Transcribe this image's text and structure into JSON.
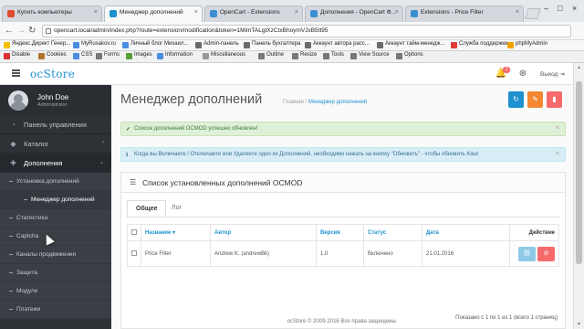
{
  "browser": {
    "tabs": [
      {
        "title": "Купить компьютеры",
        "active": false
      },
      {
        "title": "Менеджер дополнений",
        "active": true
      },
      {
        "title": "OpenCart - Extensions",
        "active": false
      },
      {
        "title": "Дополнения - OpenCart Ф...",
        "active": false
      },
      {
        "title": "Extensions - Price Filter",
        "active": false
      }
    ],
    "url": "opencart.local/admin/index.php?route=extension/modification&token=1MimTALgtXzCtxBhoymVJxB5tt95",
    "bookmarks": [
      "Яндекс.Директ Генер...",
      "MyRusakov.ru",
      "Личный блог Михаил...",
      "Admin-панель",
      "Панель бухгалтера",
      "Аккаунт автора расс...",
      "Аккаунт тайм-менедж...",
      "Служба поддержки",
      "phpMyAdmin"
    ],
    "devtools": [
      "Disable",
      "Cookies",
      "CSS",
      "Forms",
      "Images",
      "Information",
      "Miscellaneous",
      "Outline",
      "Resize",
      "Tools",
      "View Source",
      "Options"
    ]
  },
  "header": {
    "logo": "ocStore",
    "notification_count": "1",
    "logout": "Выход"
  },
  "user": {
    "name": "John Doe",
    "role": "Administrator"
  },
  "sidebar": {
    "items": [
      {
        "label": "Панель управления"
      },
      {
        "label": "Каталог"
      },
      {
        "label": "Дополнения"
      }
    ],
    "submenu": [
      {
        "label": "Установка дополнений"
      },
      {
        "label": "Менеджер дополнений"
      },
      {
        "label": "Статистика"
      },
      {
        "label": "Captcha"
      },
      {
        "label": "Каналы продвижения"
      },
      {
        "label": "Защита"
      },
      {
        "label": "Модули"
      },
      {
        "label": "Платежи"
      }
    ]
  },
  "page": {
    "title": "Менеджер дополнений",
    "breadcrumb": [
      "Главная",
      "Менеджер дополнений"
    ],
    "success_alert": "Список дополнений OCMOD успешно обновлен!",
    "info_alert": "Когда вы Включаете / Отключаете или Удаляете одно из Дополнений, необходимо нажать на кнопку \"Обновить\" - чтобы обновить Кэш!",
    "panel_title": "Список установленных дополнений OCMOD",
    "tabs": [
      "Общее",
      "Лог"
    ],
    "columns": [
      "Название",
      "Автор",
      "Версия",
      "Статус",
      "Дата",
      "Действие"
    ],
    "rows": [
      {
        "name": "Price Filter",
        "author": "Andrew K. (andrewBk)",
        "version": "1.0",
        "status": "Включено",
        "date": "21.01.2016"
      }
    ],
    "pagination": "Показано с 1 по 1 из 1 (всего 1 страниц)",
    "footer": "ocStore © 2009-2016 Все права защищены."
  },
  "colors": {
    "accent": "#1e91cf",
    "refresh": "#1e91cf",
    "clear": "#f38733",
    "delete": "#f56b6b",
    "success_bg": "#dff0d8",
    "info_bg": "#d9edf7",
    "sidebar": "#2e3237"
  }
}
